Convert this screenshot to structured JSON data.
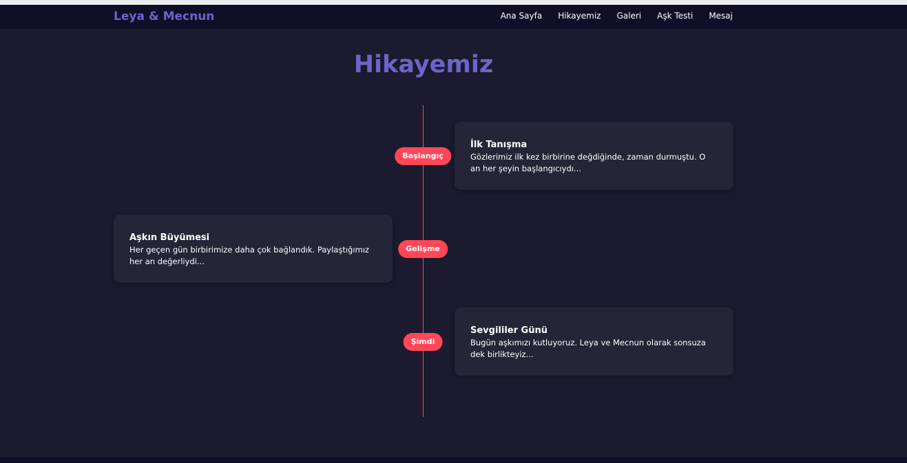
{
  "brand": "Leya & Mecnun",
  "nav": {
    "home": "Ana Sayfa",
    "story": "Hikayemiz",
    "gallery": "Galeri",
    "love_test": "Aşk Testi",
    "message": "Mesaj"
  },
  "page_title": "Hikayemiz",
  "timeline": [
    {
      "badge": "Başlangıç",
      "title": "İlk Tanışma",
      "text": "Gözlerimiz ilk kez birbirine değdiğinde, zaman durmuştu. O an her şeyin başlangıcıydı..."
    },
    {
      "badge": "Gelişme",
      "title": "Aşkın Büyümesi",
      "text": "Her geçen gün birbirimize daha çok bağlandık. Paylaştığımız her an değerliydi..."
    },
    {
      "badge": "Şimdi",
      "title": "Sevgililer Günü",
      "text": "Bugün aşkımızı kutluyoruz. Leya ve Mecnun olarak sonsuza dek birlikteyiz..."
    }
  ],
  "colors": {
    "accent": "#6c64c8",
    "badge": "#ff4757",
    "background": "#1b1a2e",
    "card": "#252538",
    "navbar": "#110e27"
  }
}
